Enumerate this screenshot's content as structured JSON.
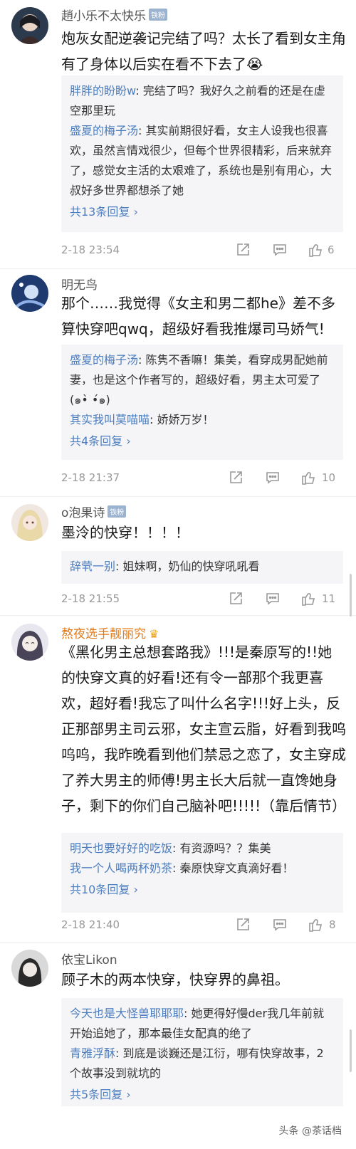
{
  "comments": [
    {
      "username": "趙小乐不太快乐",
      "badge": "铁粉",
      "content": "炮灰女配逆袭记完结了吗？太长了看到女主角有了身体以后实在看不下去了😭",
      "replies": [
        {
          "name": "胖胖的盼盼w",
          "text": ": 完结了吗？我好久之前看的还是在虚空那里玩"
        },
        {
          "name": "盛夏的梅子汤",
          "text": ": 其实前期很好看，女主人设我也很喜欢，虽然言情戏很少，但每个世界很精彩，后来就弃了，感觉女主活的太艰难了，系统也是别有用心，大叔好多世界都想杀了她"
        }
      ],
      "more": "共13条回复 ›",
      "time": "2-18 23:54",
      "likes": "6"
    },
    {
      "username": "明无鸟",
      "content": "那个……我觉得《女主和男二都he》差不多算快穿吧qwq，超级好看我推爆司马娇气!",
      "replies": [
        {
          "name": "盛夏的梅子汤",
          "text": ": 陈隽不香嘛！集美，看穿成男配她前妻，也是这个作者写的，超级好看，男主太可爱了(๑•̀ •́๑)"
        },
        {
          "name": "其实我叫莫喵喵",
          "text": ": 娇娇万岁！"
        }
      ],
      "more": "共4条回复 ›",
      "time": "2-18 21:37",
      "likes": "10"
    },
    {
      "username": "o泡果诗",
      "badge": "铁粉",
      "content": "墨泠的快穿！！！！",
      "replies": [
        {
          "name": "辞茕一别",
          "text": ": 姐妹啊，奶仙的快穿吼吼看"
        }
      ],
      "time": "2-18 21:55",
      "likes": "11"
    },
    {
      "username": "熬夜选手靓丽究",
      "content": "《黑化男主总想套路我》!!!是秦原写的!!她的快穿文真的好看!还有令一部那个我更喜欢，超好看!我忘了叫什么名字!!!好上头，反正那部男主司云邪，女主宣云脂，好看到我呜呜呜，我昨晚看到他们禁忌之恋了，女主穿成了养大男主的师傅!男主长大后就一直馋她身子，剩下的你们自己脑补吧!!!!!（靠后情节）",
      "replies": [
        {
          "name": "明天也要好好的吃饭",
          "text": ": 有资源吗？？集美"
        },
        {
          "name": "我一个人喝两杯奶茶",
          "text": ": 秦原快穿文真滴好看！"
        }
      ],
      "more": "共10条回复 ›",
      "time": "2-18 21:40",
      "likes": "8"
    },
    {
      "username": "依宝Likon",
      "content": "顾子木的两本快穿，快穿界的鼻祖。",
      "replies": [
        {
          "name": "今天也是大怪兽耶耶耶",
          "text": ": 她更得好慢der我几年前就开始追她了，那本最佳女配真的绝了"
        },
        {
          "name": "青雅浮酥",
          "text": ": 到底是谈巍还是江衍，哪有快穿故事，2个故事没到就坑的"
        }
      ],
      "more": "共5条回复 ›"
    }
  ],
  "watermark": "头条 @茶话档",
  "colors": {
    "link": "#4b7dbf",
    "orange_name": "#e07a19",
    "badge": "#9cb3d0",
    "reply_bg": "#f5f5f7"
  },
  "icons": [
    "share-icon",
    "comment-icon",
    "like-icon",
    "crown-icon"
  ]
}
